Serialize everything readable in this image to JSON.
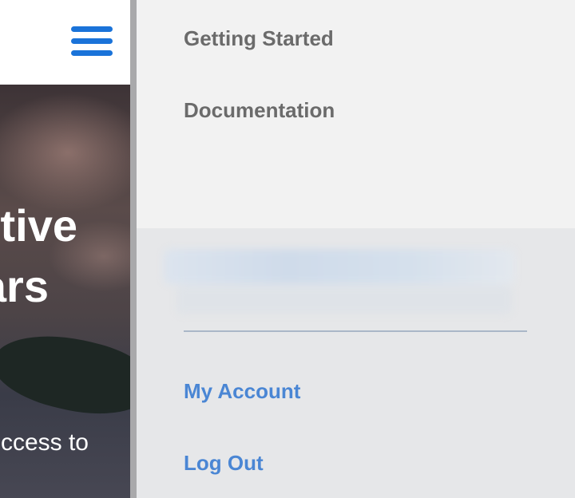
{
  "background_page": {
    "hero_line1": "tive",
    "hero_line2": "ars",
    "hero_subtext": "ccess to",
    "menu_icon": "hamburger-menu-icon"
  },
  "menu": {
    "top_links": [
      {
        "label": "Getting Started"
      },
      {
        "label": "Documentation"
      }
    ],
    "account_links": [
      {
        "label": "My Account"
      },
      {
        "label": "Log Out"
      }
    ]
  },
  "colors": {
    "accent_blue": "#1a73d9",
    "link_blue": "#4a86d4",
    "link_gray": "#6b6b6b"
  }
}
